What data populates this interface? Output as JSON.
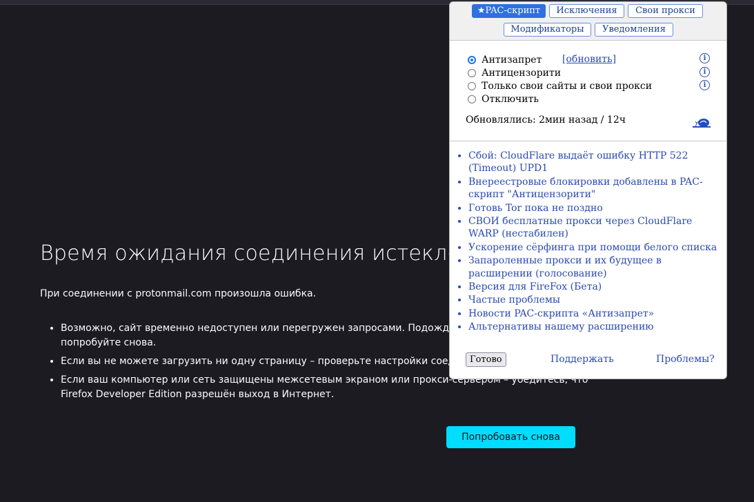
{
  "error_page": {
    "title": "Время ожидания соединения истекло",
    "description": "При соединении с protonmail.com произошла ошибка.",
    "bullets": [
      "Возможно, сайт временно недоступен или перегружен запросами. Подождите некоторое время и попробуйте снова.",
      "Если вы не можете загрузить ни одну страницу – проверьте настройки соединения с Интернетом.",
      "Если ваш компьютер или сеть защищены межсетевым экраном или прокси-сервером – убедитесь, что Firefox Developer Edition разрешён выход в Интернет."
    ],
    "retry_label": "Попробовать снова"
  },
  "popup": {
    "tabs": [
      "★PAC-скрипт",
      "Исключения",
      "Свои прокси",
      "Модификаторы",
      "Уведомления"
    ],
    "active_tab": "★PAC-скрипт",
    "modes": [
      {
        "label": "Антизапрет",
        "checked": true
      },
      {
        "label": "Антицензорити",
        "checked": false
      },
      {
        "label": "Только свои сайты и свои прокси",
        "checked": false
      },
      {
        "label": "Отключить",
        "checked": false
      }
    ],
    "update_link": "[обновить]",
    "info_icon_glyph": "i",
    "updated_text": "Обновлялись: 2мин назад / 12ч",
    "news": [
      "Сбой: CloudFlare выдаёт ошибку HTTP 522 (Timeout) UPD1",
      "Внереестровые блокировки добавлены в PAC-скрипт \"Антицензорити\"",
      "Готовь Tor пока не поздно",
      "СВОИ бесплатные прокси через CloudFlare WARP (нестабилен)",
      "Ускорение сёрфинга при помощи белого списка",
      "Запароленные прокси и их будущее в расширении (голосование)",
      "Версия для FireFox (Бета)",
      "Частые проблемы",
      "Новости PAC-скрипта «Антизапрет»",
      "Альтернативы нашему расширению"
    ],
    "done_label": "Готово",
    "support_label": "Поддержать",
    "problems_label": "Проблемы?"
  },
  "colors": {
    "page_bg": "#1c1b22",
    "retry_button": "#00ddff",
    "popup_link": "#2a4ab0",
    "active_tab": "#2f6fe0",
    "radio_checked": "#1a73e8"
  }
}
